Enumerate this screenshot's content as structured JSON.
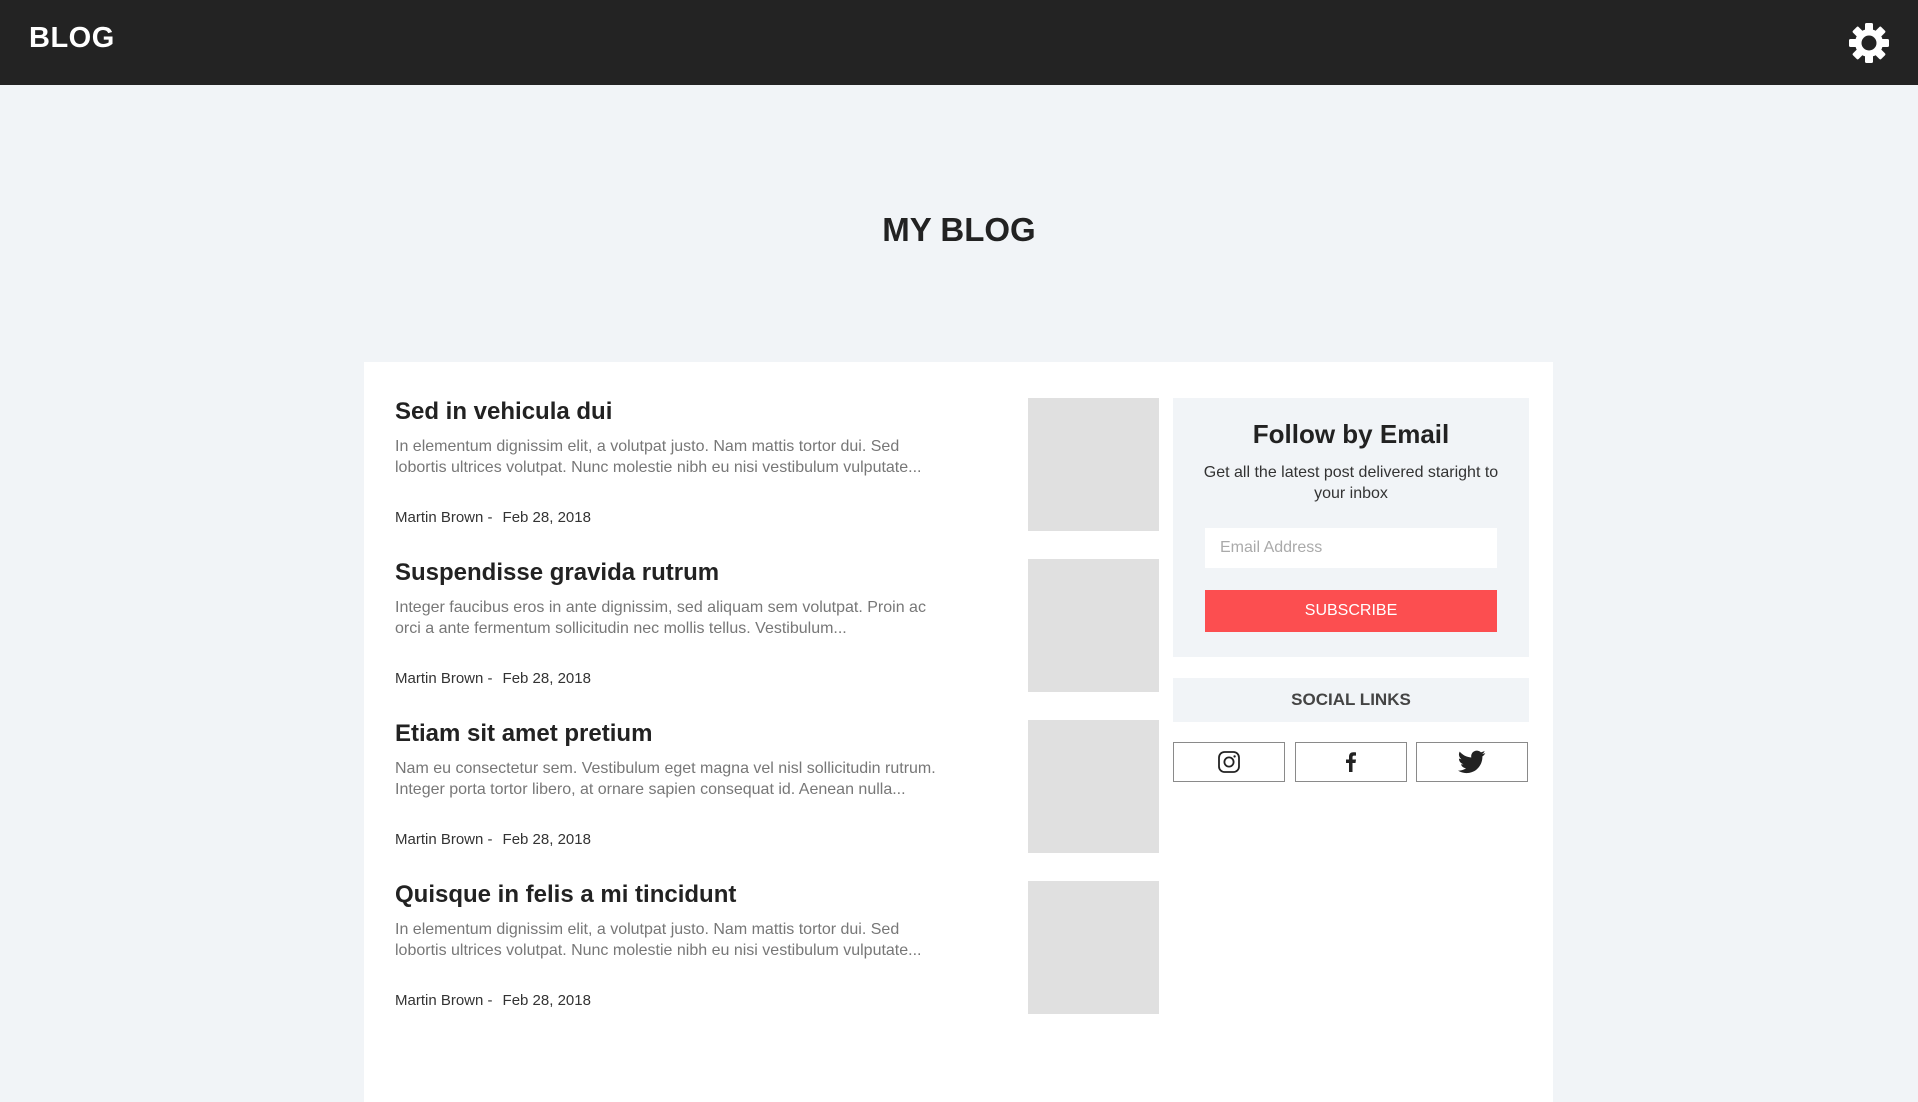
{
  "header": {
    "brand": "BLOG",
    "settings_icon": "gear-icon"
  },
  "page": {
    "title": "MY BLOG"
  },
  "posts": [
    {
      "title": "Sed in vehicula dui",
      "excerpt": "In elementum dignissim elit, a volutpat justo. Nam mattis tortor dui. Sed lobortis ultrices volutpat. Nunc molestie nibh eu nisi vestibulum vulputate...",
      "author": "Martin Brown -",
      "date": "Feb 28, 2018"
    },
    {
      "title": "Suspendisse gravida rutrum",
      "excerpt": "Integer faucibus eros in ante dignissim, sed aliquam sem volutpat. Proin ac orci a ante fermentum sollicitudin nec mollis tellus. Vestibulum...",
      "author": "Martin Brown -",
      "date": "Feb 28, 2018"
    },
    {
      "title": "Etiam sit amet pretium",
      "excerpt": "Nam eu consectetur sem. Vestibulum eget magna vel nisl sollicitudin rutrum. Integer porta tortor libero, at ornare sapien consequat id. Aenean nulla...",
      "author": "Martin Brown -",
      "date": "Feb 28, 2018"
    },
    {
      "title": "Quisque in felis a mi tincidunt",
      "excerpt": "In elementum dignissim elit, a volutpat justo. Nam mattis tortor dui. Sed lobortis ultrices volutpat. Nunc molestie nibh eu nisi vestibulum vulputate...",
      "author": "Martin Brown -",
      "date": "Feb 28, 2018"
    }
  ],
  "sidebar": {
    "follow": {
      "title": "Follow by Email",
      "text": "Get all the latest post delivered staright to your inbox",
      "email_placeholder": "Email Address",
      "email_value": "",
      "subscribe_label": "SUBSCRIBE"
    },
    "social": {
      "title": "SOCIAL LINKS",
      "links": [
        {
          "icon": "instagram-icon"
        },
        {
          "icon": "facebook-icon"
        },
        {
          "icon": "twitter-icon"
        }
      ]
    }
  },
  "colors": {
    "topbar": "#232323",
    "background": "#f1f4f7",
    "accent": "#fc4e50",
    "thumbnail": "#e0e0e0"
  }
}
